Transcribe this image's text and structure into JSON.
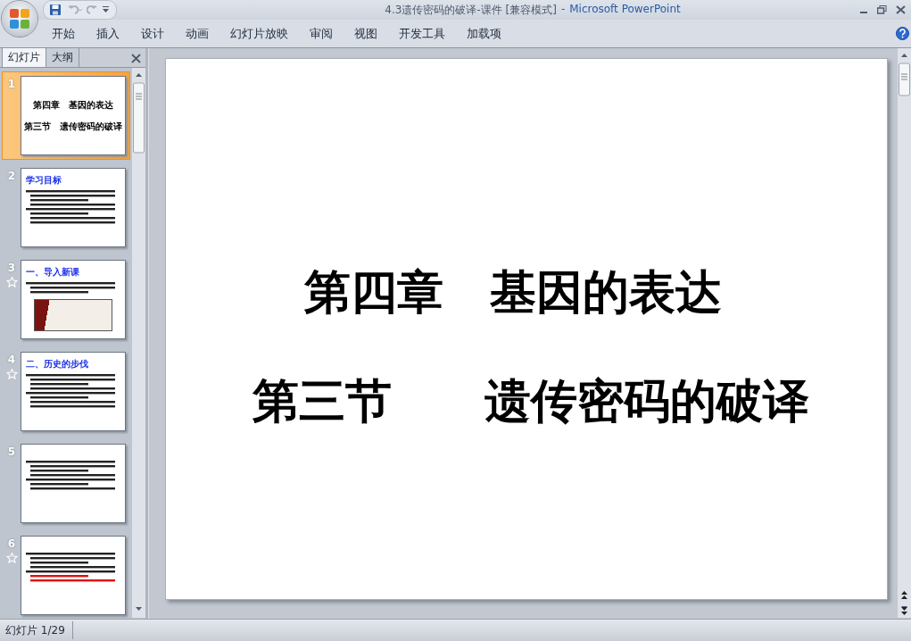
{
  "window": {
    "document_title": "4.3遗传密码的破译-课件 [兼容模式]",
    "separator": "-",
    "app_name": "Microsoft PowerPoint"
  },
  "quick_access": [
    {
      "kind": "save",
      "disabled": false
    },
    {
      "kind": "undo",
      "disabled": true
    },
    {
      "kind": "redo",
      "disabled": true
    }
  ],
  "ribbon_tabs": [
    "开始",
    "插入",
    "设计",
    "动画",
    "幻灯片放映",
    "审阅",
    "视图",
    "开发工具",
    "加载项"
  ],
  "pane_tabs": [
    {
      "label": "幻灯片",
      "selected": true
    },
    {
      "label": "大纲",
      "selected": false
    }
  ],
  "slides": [
    {
      "number": "1",
      "selected": true,
      "animated": false,
      "kind": "title",
      "lines": [
        "第四章　基因的表达",
        "第三节　遗传密码的破译"
      ]
    },
    {
      "number": "2",
      "selected": false,
      "animated": false,
      "kind": "text",
      "heading": "学习目标"
    },
    {
      "number": "3",
      "selected": false,
      "animated": true,
      "kind": "picture",
      "heading": "一、导入新课"
    },
    {
      "number": "4",
      "selected": false,
      "animated": true,
      "kind": "text",
      "heading": "二、历史的步伐"
    },
    {
      "number": "5",
      "selected": false,
      "animated": false,
      "kind": "text"
    },
    {
      "number": "6",
      "selected": false,
      "animated": true,
      "kind": "text"
    }
  ],
  "current_slide": {
    "lines": [
      "第四章　基因的表达",
      "第三节　　遗传密码的破译"
    ]
  },
  "status_bar": {
    "slide_indicator": "幻灯片 1/29"
  }
}
